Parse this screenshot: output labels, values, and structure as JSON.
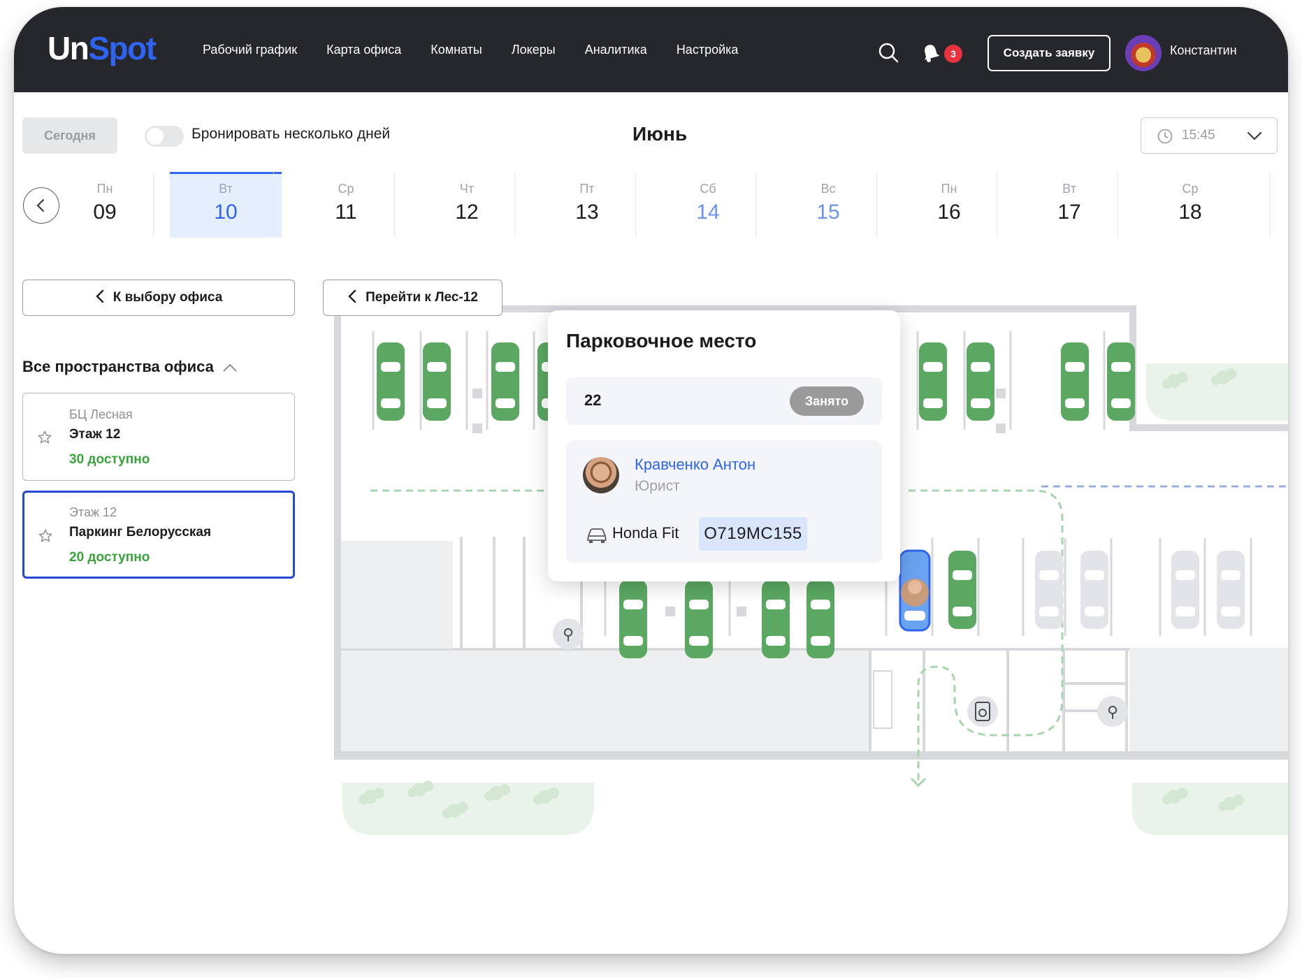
{
  "app": {
    "logo_part1": "Un",
    "logo_part2": "Spot",
    "brand_color": "#2e64f0"
  },
  "nav": {
    "items": [
      "Рабочий график",
      "Карта офиса",
      "Комнаты",
      "Локеры",
      "Аналитика",
      "Настройка"
    ]
  },
  "header": {
    "notifications_count": "3",
    "create_button": "Создать заявку",
    "user_name": "Константин",
    "icons": [
      "search-icon",
      "bell-icon"
    ]
  },
  "toolbar": {
    "today": "Сегодня",
    "multi_day_label": "Бронировать несколько дней",
    "multi_day_enabled": false,
    "month": "Июнь",
    "time": "15:45"
  },
  "calendar": {
    "days": [
      {
        "name": "Пн",
        "date": "09",
        "selected": false,
        "weekend": false
      },
      {
        "name": "Вт",
        "date": "10",
        "selected": true,
        "weekend": false
      },
      {
        "name": "Ср",
        "date": "11",
        "selected": false,
        "weekend": false
      },
      {
        "name": "Чт",
        "date": "12",
        "selected": false,
        "weekend": false
      },
      {
        "name": "Пт",
        "date": "13",
        "selected": false,
        "weekend": false
      },
      {
        "name": "Сб",
        "date": "14",
        "selected": false,
        "weekend": true
      },
      {
        "name": "Вс",
        "date": "15",
        "selected": false,
        "weekend": true
      },
      {
        "name": "Пн",
        "date": "16",
        "selected": false,
        "weekend": false
      },
      {
        "name": "Вт",
        "date": "17",
        "selected": false,
        "weekend": false
      },
      {
        "name": "Ср",
        "date": "18",
        "selected": false,
        "weekend": false
      }
    ]
  },
  "sidebar": {
    "back_button": "К выбору офиса",
    "spaces_title": "Все пространства офиса",
    "offices": [
      {
        "line1": "БЦ Лесная",
        "line2": "Этаж 12",
        "line3": "30 доступно",
        "selected": false
      },
      {
        "line1": "Этаж 12",
        "line2": "Паркинг Белорусская",
        "line3": "20 доступно",
        "selected": true
      }
    ]
  },
  "map": {
    "goto_button": "Перейти к Лес-12",
    "occupied_color": "#5aa862",
    "free_color": "#e3e4e7",
    "accent_path_color": "#2e64f0"
  },
  "popup": {
    "title": "Парковочное место",
    "spot_number": "22",
    "status": "Занято",
    "person_name": "Кравченко Антон",
    "person_role": "Юрист",
    "car_model": "Honda Fit",
    "car_plate": "О719МС155"
  }
}
